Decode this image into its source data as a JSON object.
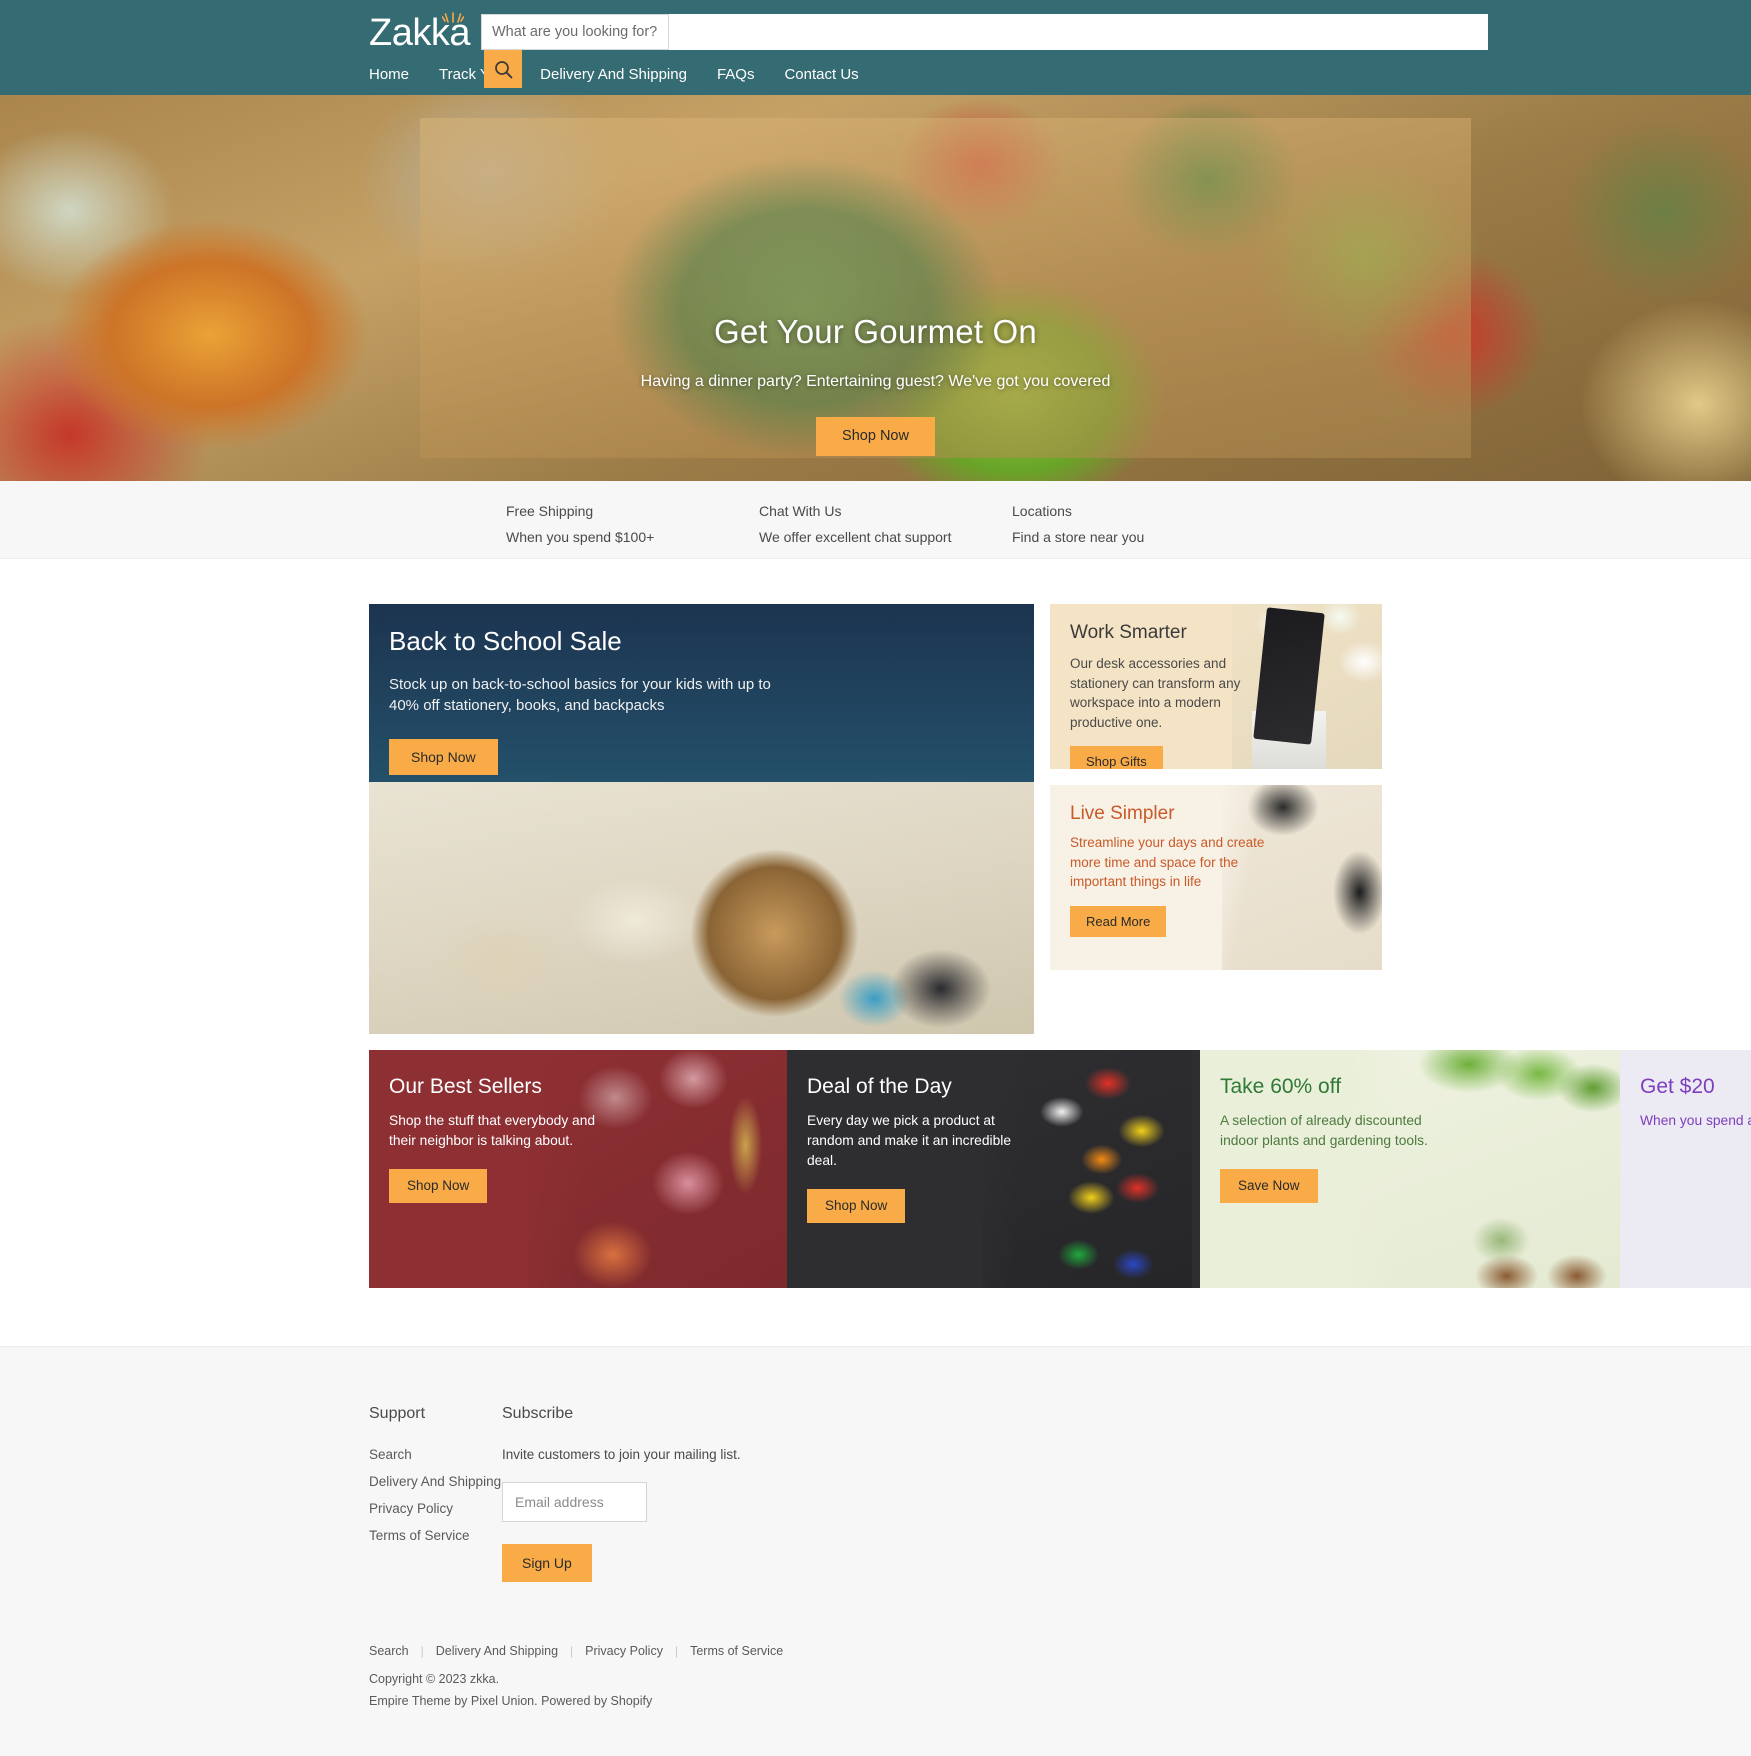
{
  "header": {
    "logo": "Zakka",
    "logo_icon": "sparkle-burst-icon",
    "search_placeholder": "What are you looking for?",
    "search_value": "",
    "search_button_icon": "search-icon",
    "cart_icon": "shopping-cart-icon",
    "nav": [
      {
        "label": "Home"
      },
      {
        "label": "Track Your"
      },
      {
        "label": "Delivery And Shipping"
      },
      {
        "label": "FAQs"
      },
      {
        "label": "Contact Us"
      }
    ]
  },
  "hero": {
    "title": "Get Your Gourmet On",
    "subtitle": "Having a dinner party? Entertaining guest? We've got you covered",
    "cta": "Shop Now"
  },
  "services": [
    {
      "title": "Free Shipping",
      "text": "When you spend $100+"
    },
    {
      "title": "Chat With Us",
      "text": "We offer excellent chat support"
    },
    {
      "title": "Locations",
      "text": "Find a store near you"
    }
  ],
  "promos_row1": {
    "school": {
      "title": "Back to School Sale",
      "text": "Stock up on back-to-school basics for your kids with up to 40% off stationery, books, and backpacks",
      "cta": "Shop Now"
    },
    "work": {
      "title": "Work Smarter",
      "text": "Our desk accessories and stationery can transform any workspace into a modern productive one.",
      "cta": "Shop Gifts"
    },
    "live": {
      "title": "Live Simpler",
      "text": "Streamline your days and create more time and space for the important things in life",
      "cta": "Read More"
    }
  },
  "promos_row2": [
    {
      "title": "Our Best Sellers",
      "text": "Shop the stuff that everybody and their neighbor is talking about.",
      "cta": "Shop Now"
    },
    {
      "title": "Deal of the Day",
      "text": "Every day we pick a product at random and make it an incredible deal.",
      "cta": "Shop Now"
    },
    {
      "title": "Take 60% off",
      "text": "A selection of already discounted indoor plants and gardening tools.",
      "cta": "Save Now"
    },
    {
      "title": "Get $20",
      "text": "When you spend and online with",
      "cta": ""
    }
  ],
  "footer": {
    "support_title": "Support",
    "support_links": [
      {
        "label": "Search"
      },
      {
        "label": "Delivery And Shipping"
      },
      {
        "label": "Privacy Policy"
      },
      {
        "label": "Terms of Service"
      }
    ],
    "subscribe_title": "Subscribe",
    "subscribe_desc": "Invite customers to join your mailing list.",
    "email_placeholder": "Email address",
    "email_value": "",
    "signup_label": "Sign Up",
    "bottom_links": [
      {
        "label": "Search"
      },
      {
        "label": "Delivery And Shipping"
      },
      {
        "label": "Privacy Policy"
      },
      {
        "label": "Terms of Service"
      }
    ],
    "copyright": "Copyright © 2023 zkka.",
    "theme_credit": "Empire Theme by Pixel Union. Powered by Shopify"
  },
  "colors": {
    "header_teal": "#356b72",
    "accent_orange": "#f9ab48",
    "school_navy": "#1f3b54",
    "best_sellers_red": "#8e2f33",
    "deal_dark": "#2e2e31",
    "plants_green_bg": "#eaefd9",
    "plants_green_text": "#2f7a36",
    "twenty_purple": "#7d3fbd",
    "live_simpler_orange": "#cb5a29"
  }
}
